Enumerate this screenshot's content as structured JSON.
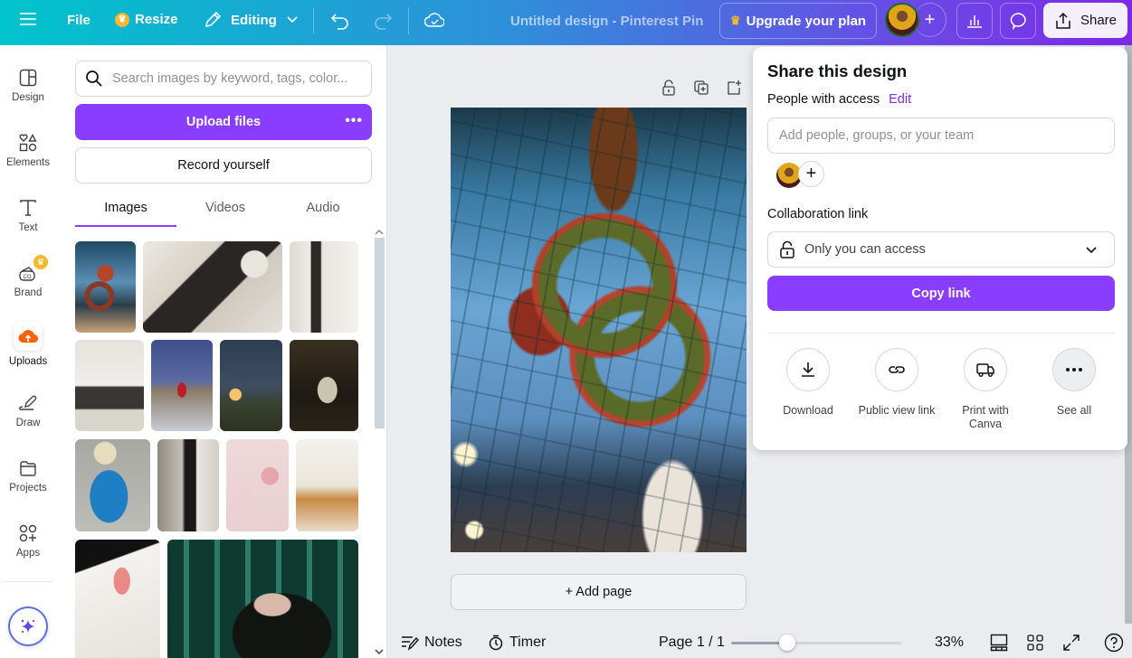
{
  "topbar": {
    "menu_icon": "hamburger-menu-icon",
    "file_label": "File",
    "resize_label": "Resize",
    "editing_label": "Editing",
    "design_title": "Untitled design - Pinterest Pin",
    "upgrade_label": "Upgrade your plan",
    "share_label": "Share",
    "colors": {
      "gradient_start": "#00c4cc",
      "gradient_end": "#7d2ae8",
      "crown": "#f5b82e"
    }
  },
  "rail": {
    "items": [
      {
        "label": "Design",
        "icon": "design-layout-icon"
      },
      {
        "label": "Elements",
        "icon": "elements-shapes-icon"
      },
      {
        "label": "Text",
        "icon": "text-t-icon"
      },
      {
        "label": "Brand",
        "icon": "brand-kit-icon"
      },
      {
        "label": "Uploads",
        "icon": "upload-cloud-icon"
      },
      {
        "label": "Draw",
        "icon": "draw-pen-icon"
      },
      {
        "label": "Projects",
        "icon": "folder-icon"
      },
      {
        "label": "Apps",
        "icon": "apps-grid-icon"
      }
    ],
    "active": "Uploads",
    "magic_icon": "magic-sparkle-icon"
  },
  "uploads_panel": {
    "search_placeholder": "Search images by keyword, tags, color...",
    "upload_label": "Upload files",
    "more_label": "•••",
    "record_label": "Record yourself",
    "tabs": [
      {
        "label": "Images",
        "active": true
      },
      {
        "label": "Videos",
        "active": false
      },
      {
        "label": "Audio",
        "active": false
      }
    ],
    "images": [
      "Christmas wreaths in glass hall",
      "Woman reading in white room",
      "Woman at desk by window",
      "Woman at desk in lounge",
      "Person in red coat on bridge",
      "Woman with scarf at dusk",
      "Dark restaurant interior",
      "Person in blue jacket and beanie",
      "Woman in black dress on street",
      "Pink cosmetics flat lay",
      "Bright cafe interior",
      "Cocktail glasses pour",
      "Woman in sunglasses green background"
    ]
  },
  "canvas": {
    "page_tool_icons": [
      "lock-icon",
      "duplicate-page-icon",
      "add-page-icon"
    ],
    "add_page_label": "+ Add page",
    "design_image": "Christmas wreaths hanging in glass-roofed market hall"
  },
  "bottombar": {
    "notes_label": "Notes",
    "timer_label": "Timer",
    "page_label": "Page 1 / 1",
    "zoom_label": "33%",
    "zoom_fraction": 0.33
  },
  "share_popup": {
    "title": "Share this design",
    "people_label": "People with access",
    "edit_label": "Edit",
    "people_placeholder": "Add people, groups, or your team",
    "collab_label": "Collaboration link",
    "access_value": "Only you can access",
    "copy_label": "Copy link",
    "actions": [
      {
        "label": "Download",
        "icon": "download-icon"
      },
      {
        "label": "Public view link",
        "icon": "link-icon"
      },
      {
        "label": "Print with Canva",
        "icon": "delivery-truck-icon"
      },
      {
        "label": "See all",
        "icon": "more-dots-icon"
      }
    ],
    "accent": "#8b3dff"
  }
}
